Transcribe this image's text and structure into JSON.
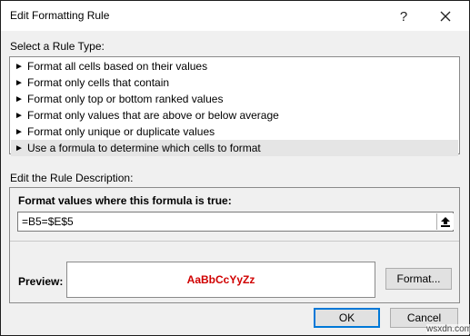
{
  "window": {
    "title": "Edit Formatting Rule",
    "help_label": "?"
  },
  "rule_type": {
    "label": "Select a Rule Type:",
    "items": [
      {
        "label": "Format all cells based on their values"
      },
      {
        "label": "Format only cells that contain"
      },
      {
        "label": "Format only top or bottom ranked values"
      },
      {
        "label": "Format only values that are above or below average"
      },
      {
        "label": "Format only unique or duplicate values"
      },
      {
        "label": "Use a formula to determine which cells to format",
        "selected": true
      }
    ],
    "arrow_glyph": "►"
  },
  "description": {
    "label": "Edit the Rule Description:",
    "formula_label": "Format values where this formula is true:",
    "formula_value": "=B5=$E$5"
  },
  "preview": {
    "label": "Preview:",
    "sample_text": "AaBbCcYyZz",
    "sample_color": "#d00000",
    "format_button": "Format..."
  },
  "buttons": {
    "ok": "OK",
    "cancel": "Cancel"
  },
  "watermark": "wsxdn.com"
}
